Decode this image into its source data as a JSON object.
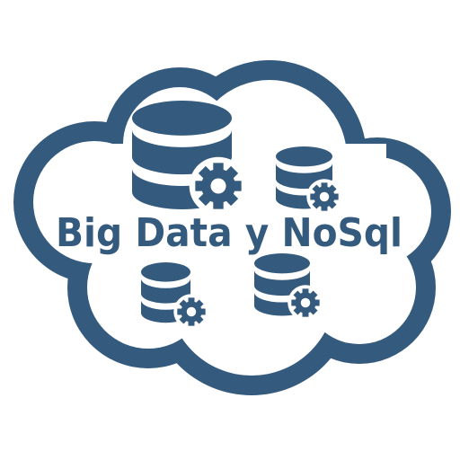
{
  "logo": {
    "title": "Big Data y NoSql",
    "brand_color": "#345a7e",
    "background_color": "#ffffff",
    "icons": [
      "cloud-icon",
      "database-icon",
      "gear-icon"
    ]
  }
}
